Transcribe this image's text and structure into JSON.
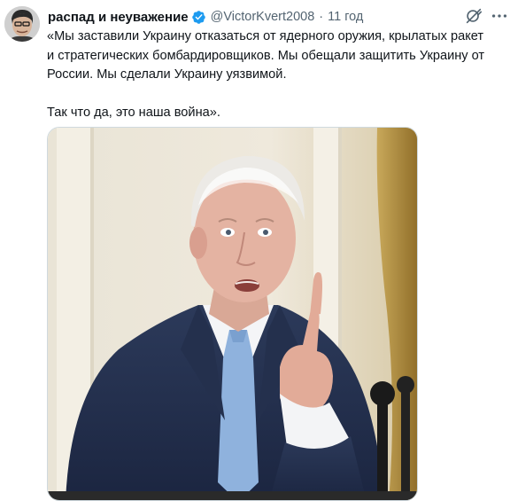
{
  "author": {
    "display_name": "распад и неуважение",
    "handle": "@VictorKvert2008",
    "separator": "·",
    "timestamp": "11 год",
    "verified": true,
    "verified_color": "#1d9bf0"
  },
  "actions": {
    "grok_icon": "grok-icon",
    "more_icon": "more-icon"
  },
  "tweet": {
    "line1": "«Мы заставили Украину отказаться от ядерного оружия, крылатых ракет",
    "line2": "и стратегических бомбардировщиков. Мы обещали защитить Украину от",
    "line3": "России. Мы сделали Украину уязвимой.",
    "line4": "Так что да, это наша война»."
  },
  "colors": {
    "text": "#0f1419",
    "secondary": "#536471",
    "border": "#cfd9de"
  }
}
